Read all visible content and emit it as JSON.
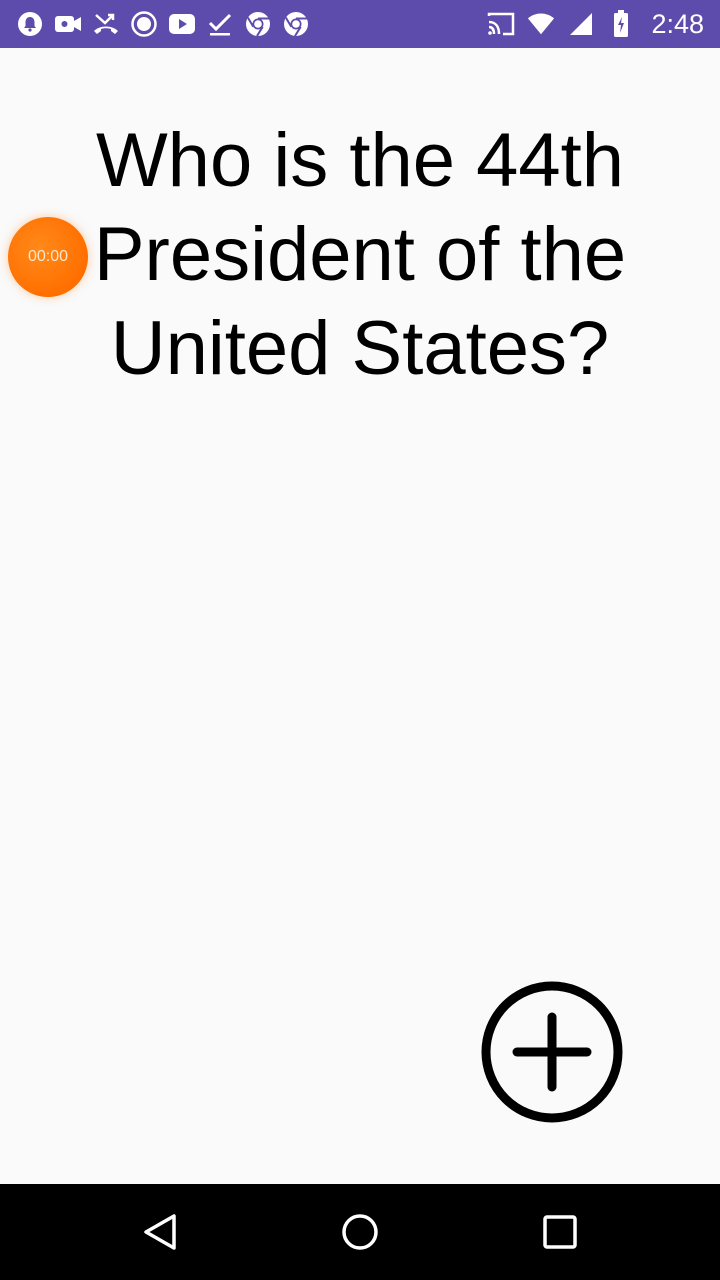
{
  "status_bar": {
    "time": "2:48",
    "background_color": "#5d4cab",
    "left_icons": [
      "notification-icon",
      "video-camera-icon",
      "missed-call-icon",
      "record-icon",
      "youtube-icon",
      "download-done-icon",
      "chrome-icon",
      "chrome-icon"
    ],
    "right_icons": [
      "cast-icon",
      "wifi-icon",
      "signal-icon",
      "battery-charging-icon"
    ]
  },
  "main": {
    "question": "Who is the 44th President of the United States?",
    "timer": "00:00",
    "timer_color": "#ff6f00"
  },
  "nav_bar": {
    "buttons": [
      "back-icon",
      "home-icon",
      "recents-icon"
    ]
  }
}
